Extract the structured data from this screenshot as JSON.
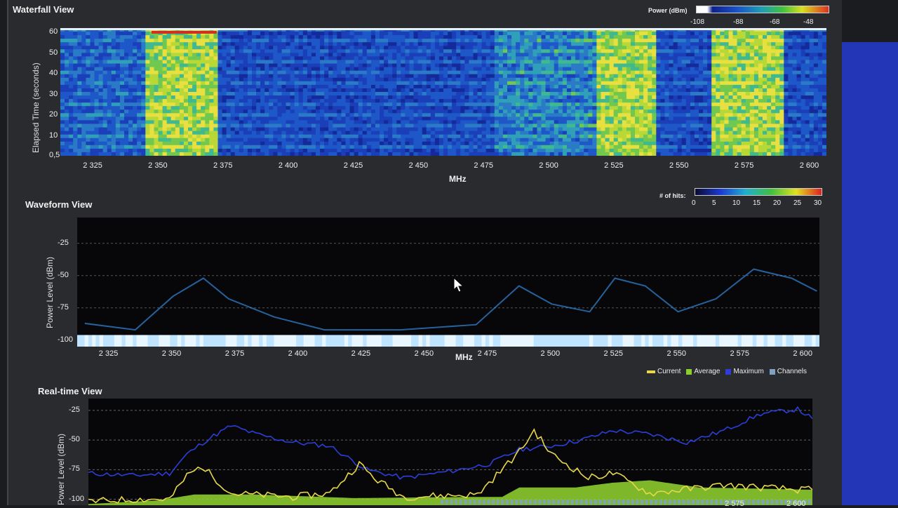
{
  "colors": {
    "current": "#e8d84a",
    "average": "#8ccc2e",
    "maximum": "#2b3fd8",
    "channels": "#7fa2c2"
  },
  "waterfall": {
    "title": "Waterfall View",
    "ylabel": "Elapsed Time (seconds)",
    "xlabel": "MHz",
    "yticks": [
      "60",
      "50",
      "40",
      "30",
      "20",
      "10",
      "0,5"
    ],
    "xticks": [
      "2 325",
      "2 350",
      "2 375",
      "2 400",
      "2 425",
      "2 450",
      "2 475",
      "2 500",
      "2 525",
      "2 550",
      "2 575",
      "2 600"
    ],
    "legend_title": "Power (dBm)",
    "legend_ticks": [
      "-108",
      "-88",
      "-68",
      "-48"
    ]
  },
  "waveform": {
    "title": "Waveform View",
    "ylabel": "Power Level (dBm)",
    "xlabel": "MHz",
    "yticks": [
      "-25",
      "-50",
      "-75",
      "-100"
    ],
    "xticks": [
      "2 325",
      "2 350",
      "2 375",
      "2 400",
      "2 425",
      "2 450",
      "2 475",
      "2 500",
      "2 525",
      "2 550",
      "2 575",
      "2 600"
    ],
    "legend_title": "# of hits:",
    "legend_ticks": [
      "0",
      "5",
      "10",
      "15",
      "20",
      "25",
      "30"
    ]
  },
  "realtime": {
    "title": "Real-time View",
    "ylabel": "Power Level (dBm)",
    "yticks": [
      "-25",
      "-50",
      "-75",
      "-100"
    ],
    "xticks": [
      "2 575",
      "2 600"
    ],
    "legend": {
      "current": "Current",
      "average": "Average",
      "maximum": "Maximum",
      "channels": "Channels"
    }
  },
  "chart_data": [
    {
      "type": "heatmap",
      "title": "Waterfall View",
      "xlabel": "MHz",
      "ylabel": "Elapsed Time (seconds)",
      "xlim": [
        2312,
        2606
      ],
      "ylim": [
        0.5,
        62
      ],
      "hot_bands_mhz": [
        [
          2345,
          2372
        ],
        [
          2518,
          2540
        ],
        [
          2562,
          2590
        ]
      ],
      "power_range_dbm": [
        -108,
        -40
      ]
    },
    {
      "type": "heatmap",
      "title": "Waveform View",
      "xlabel": "MHz",
      "ylabel": "Power Level (dBm)",
      "xlim": [
        2312,
        2606
      ],
      "ylim": [
        -105,
        -5
      ],
      "peak_traces": [
        {
          "x": [
            2315,
            2335,
            2350,
            2362,
            2372,
            2390,
            2410,
            2440,
            2470,
            2487,
            2500,
            2515,
            2525,
            2537,
            2550,
            2565,
            2580,
            2595,
            2605
          ],
          "y": [
            -87,
            -92,
            -66,
            -52,
            -68,
            -82,
            -92,
            -92,
            -88,
            -58,
            -72,
            -78,
            -52,
            -58,
            -78,
            -68,
            -45,
            -52,
            -62
          ]
        }
      ]
    },
    {
      "type": "line",
      "title": "Real-time View",
      "ylabel": "Power Level (dBm)",
      "xlim": [
        2312,
        2606
      ],
      "ylim": [
        -105,
        -15
      ],
      "series": [
        {
          "name": "Maximum",
          "x": [
            2312,
            2330,
            2345,
            2352,
            2360,
            2370,
            2380,
            2395,
            2410,
            2425,
            2440,
            2460,
            2475,
            2487,
            2500,
            2512,
            2525,
            2540,
            2555,
            2570,
            2585,
            2600,
            2606
          ],
          "y": [
            -78,
            -80,
            -78,
            -62,
            -50,
            -38,
            -45,
            -52,
            -55,
            -75,
            -82,
            -76,
            -70,
            -58,
            -55,
            -50,
            -42,
            -45,
            -52,
            -42,
            -28,
            -24,
            -32
          ]
        },
        {
          "name": "Current",
          "x": [
            2312,
            2330,
            2345,
            2352,
            2358,
            2370,
            2395,
            2410,
            2422,
            2428,
            2440,
            2470,
            2487,
            2493,
            2500,
            2515,
            2525,
            2540,
            2570,
            2600,
            2606
          ],
          "y": [
            -102,
            -100,
            -100,
            -80,
            -72,
            -95,
            -98,
            -95,
            -70,
            -82,
            -98,
            -96,
            -60,
            -42,
            -62,
            -82,
            -78,
            -95,
            -88,
            -92,
            -92
          ]
        },
        {
          "name": "Average",
          "x": [
            2312,
            2340,
            2355,
            2380,
            2420,
            2470,
            2480,
            2487,
            2510,
            2525,
            2540,
            2560,
            2606
          ],
          "y": [
            -104,
            -101,
            -96,
            -96,
            -99,
            -98,
            -98,
            -90,
            -90,
            -86,
            -84,
            -90,
            -92
          ]
        }
      ]
    }
  ]
}
